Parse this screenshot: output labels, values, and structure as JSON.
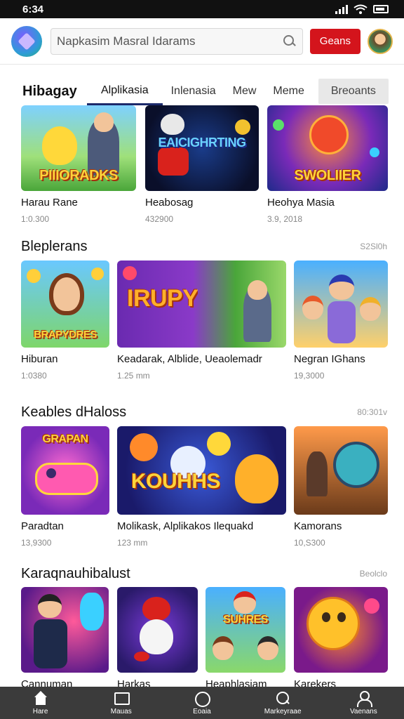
{
  "status_bar": {
    "time": "6:34"
  },
  "header": {
    "search_text": "Napkasim Masral Idarams",
    "action_label": "Geans"
  },
  "tabs": [
    {
      "label": "Hibagay"
    },
    {
      "label": "Alplikasia"
    },
    {
      "label": "Inlenasia"
    },
    {
      "label": "Mew"
    },
    {
      "label": "Meme"
    },
    {
      "label": "Breoants"
    }
  ],
  "sections": [
    {
      "title": "",
      "more": "",
      "items": [
        {
          "name": "Harau Rane",
          "meta": "1:0.300",
          "art": "PIIIORADKS"
        },
        {
          "name": "Heabosag",
          "meta": "432900",
          "art": "EAICIGHRTING"
        },
        {
          "name": "Heohya Masia",
          "meta": "3.9, 2018",
          "art": "SWOLIIER"
        }
      ]
    },
    {
      "title": "Bleplerans",
      "more": "S2Sl0h",
      "items": [
        {
          "name": "Hiburan",
          "meta": "1:0380",
          "art": "BRAPYDRES"
        },
        {
          "name": "Keadarak, Alblide, Ueaolemadr",
          "meta": "1.25 mm",
          "art": "IRUPY"
        },
        {
          "name": "Negran IGhans",
          "meta": "19,3000",
          "art": ""
        }
      ]
    },
    {
      "title": "Keables dHaloss",
      "more": "80:301v",
      "items": [
        {
          "name": "Paradtan",
          "meta": "13,9300",
          "art": "GRAPAN"
        },
        {
          "name": "Molikask, Alplikakos Ilequakd",
          "meta": "123 mm",
          "art": "KOUHHS"
        },
        {
          "name": "Kamorans",
          "meta": "10,S300",
          "art": ""
        }
      ]
    },
    {
      "title": "Karaqnauhibalust",
      "more": "Beolclo",
      "items": [
        {
          "name": "Cannuman",
          "meta": "",
          "art": ""
        },
        {
          "name": "Harkas",
          "meta": "",
          "art": ""
        },
        {
          "name": "Heaphlasiam",
          "meta": "",
          "art": "SUHRES"
        },
        {
          "name": "Karekers",
          "meta": "",
          "art": ""
        }
      ]
    }
  ],
  "bottom_nav": [
    {
      "label": "Hare",
      "icon": "home-icon"
    },
    {
      "label": "Mauas",
      "icon": "message-icon"
    },
    {
      "label": "Eoaia",
      "icon": "circle-icon"
    },
    {
      "label": "Markeyraae",
      "icon": "search-icon"
    },
    {
      "label": "Vaenans",
      "icon": "user-icon"
    }
  ],
  "colors": {
    "accent": "#d4141c",
    "tab_underline": "#1c2a6b",
    "nav_bg": "#3b3b3b"
  }
}
